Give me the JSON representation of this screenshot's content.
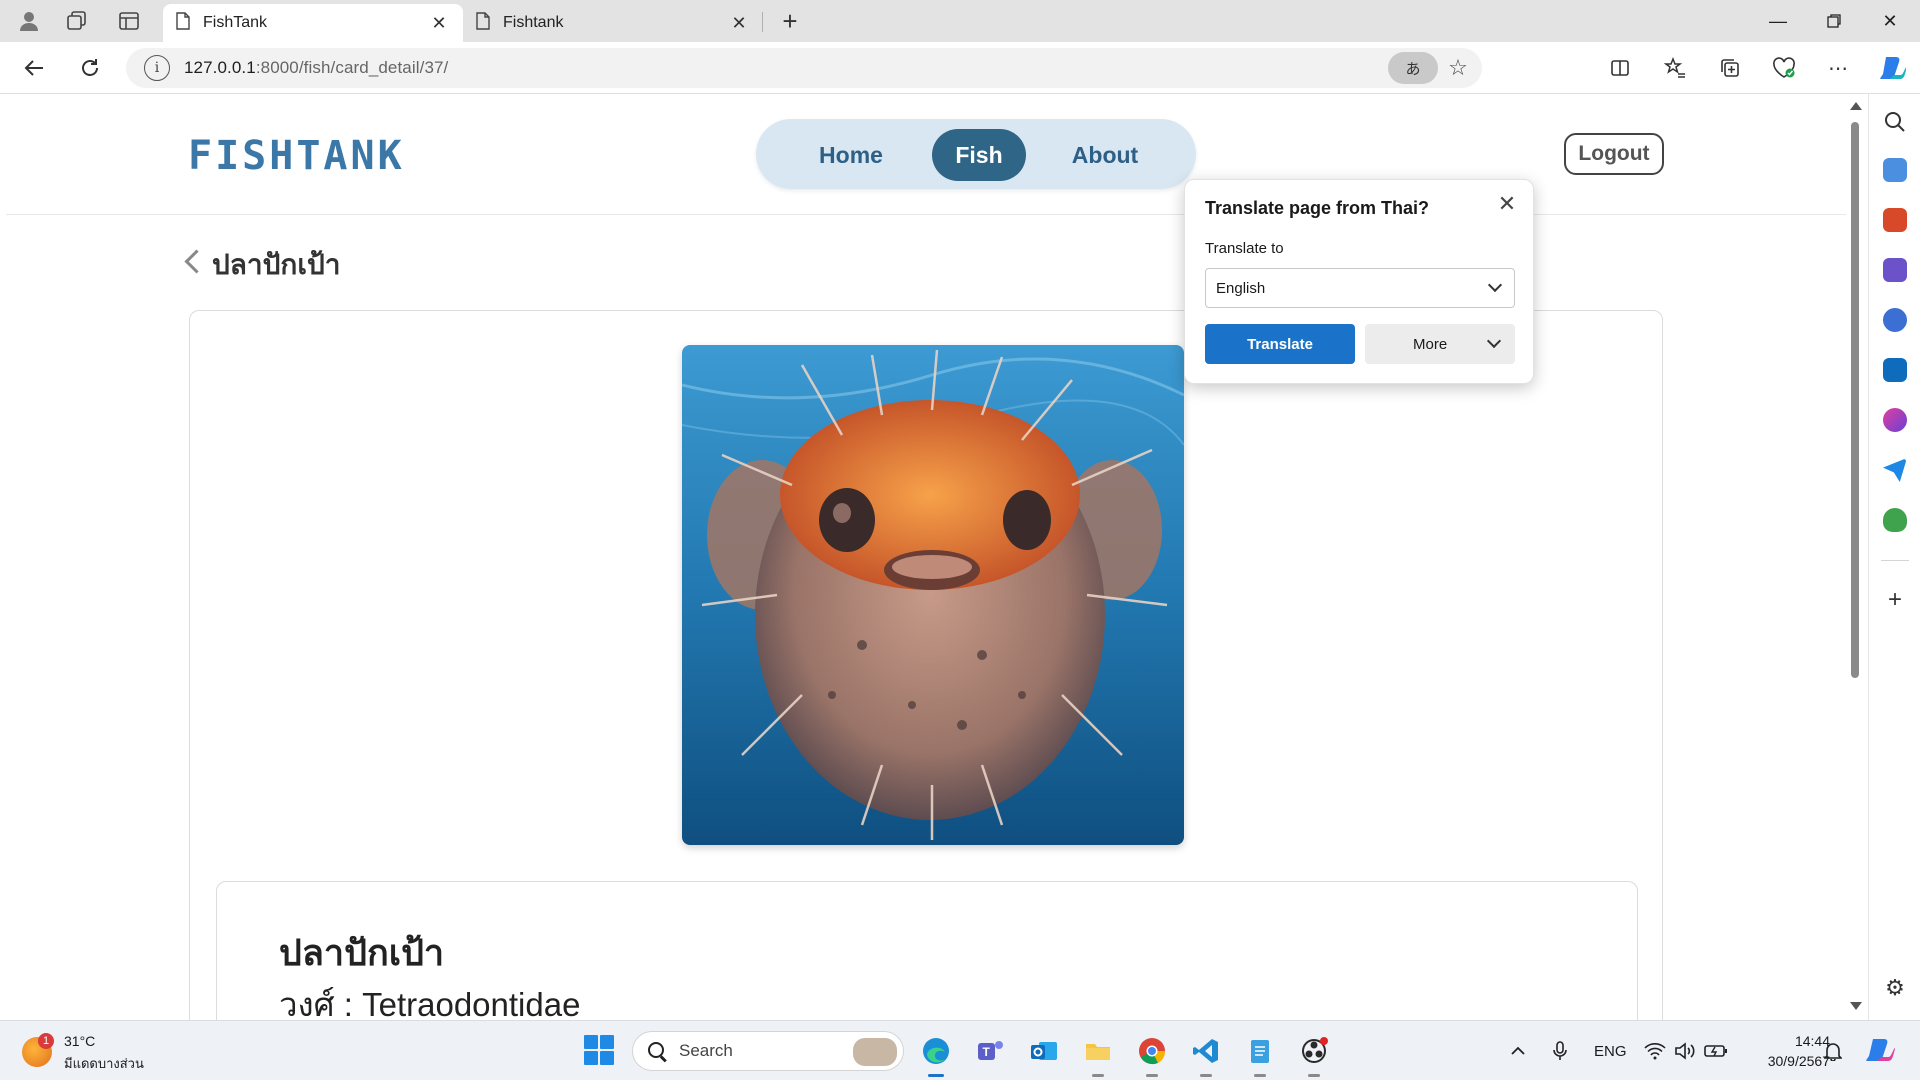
{
  "browser": {
    "tabs": [
      {
        "title": "FishTank",
        "active": true
      },
      {
        "title": "Fishtank",
        "active": false
      }
    ],
    "address": {
      "host": "127.0.0.1",
      "path": ":8000/fish/card_detail/37/"
    },
    "translate_pill": "あ"
  },
  "site": {
    "logo": "FISHTANK",
    "nav": {
      "home": "Home",
      "fish": "Fish",
      "about": "About"
    },
    "logout": "Logout"
  },
  "detail": {
    "title": "ปลาปักเป้า",
    "fish_name": "ปลาปักเป้า",
    "family": "วงศ์ : Tetraodontidae"
  },
  "translate_popup": {
    "title": "Translate page from Thai?",
    "label": "Translate to",
    "selected_language": "English",
    "translate_button": "Translate",
    "more_button": "More"
  },
  "taskbar": {
    "weather_temp": "31°C",
    "weather_desc": "มีแดดบางส่วน",
    "weather_badge": "1",
    "search_label": "Search",
    "language": "ENG",
    "time": "14:44",
    "date": "30/9/2567"
  },
  "colors": {
    "brand": "#3b78a8",
    "nav_active": "#2f6587",
    "nav_pill": "#d8e7f1",
    "translate_button": "#1a73c9"
  }
}
